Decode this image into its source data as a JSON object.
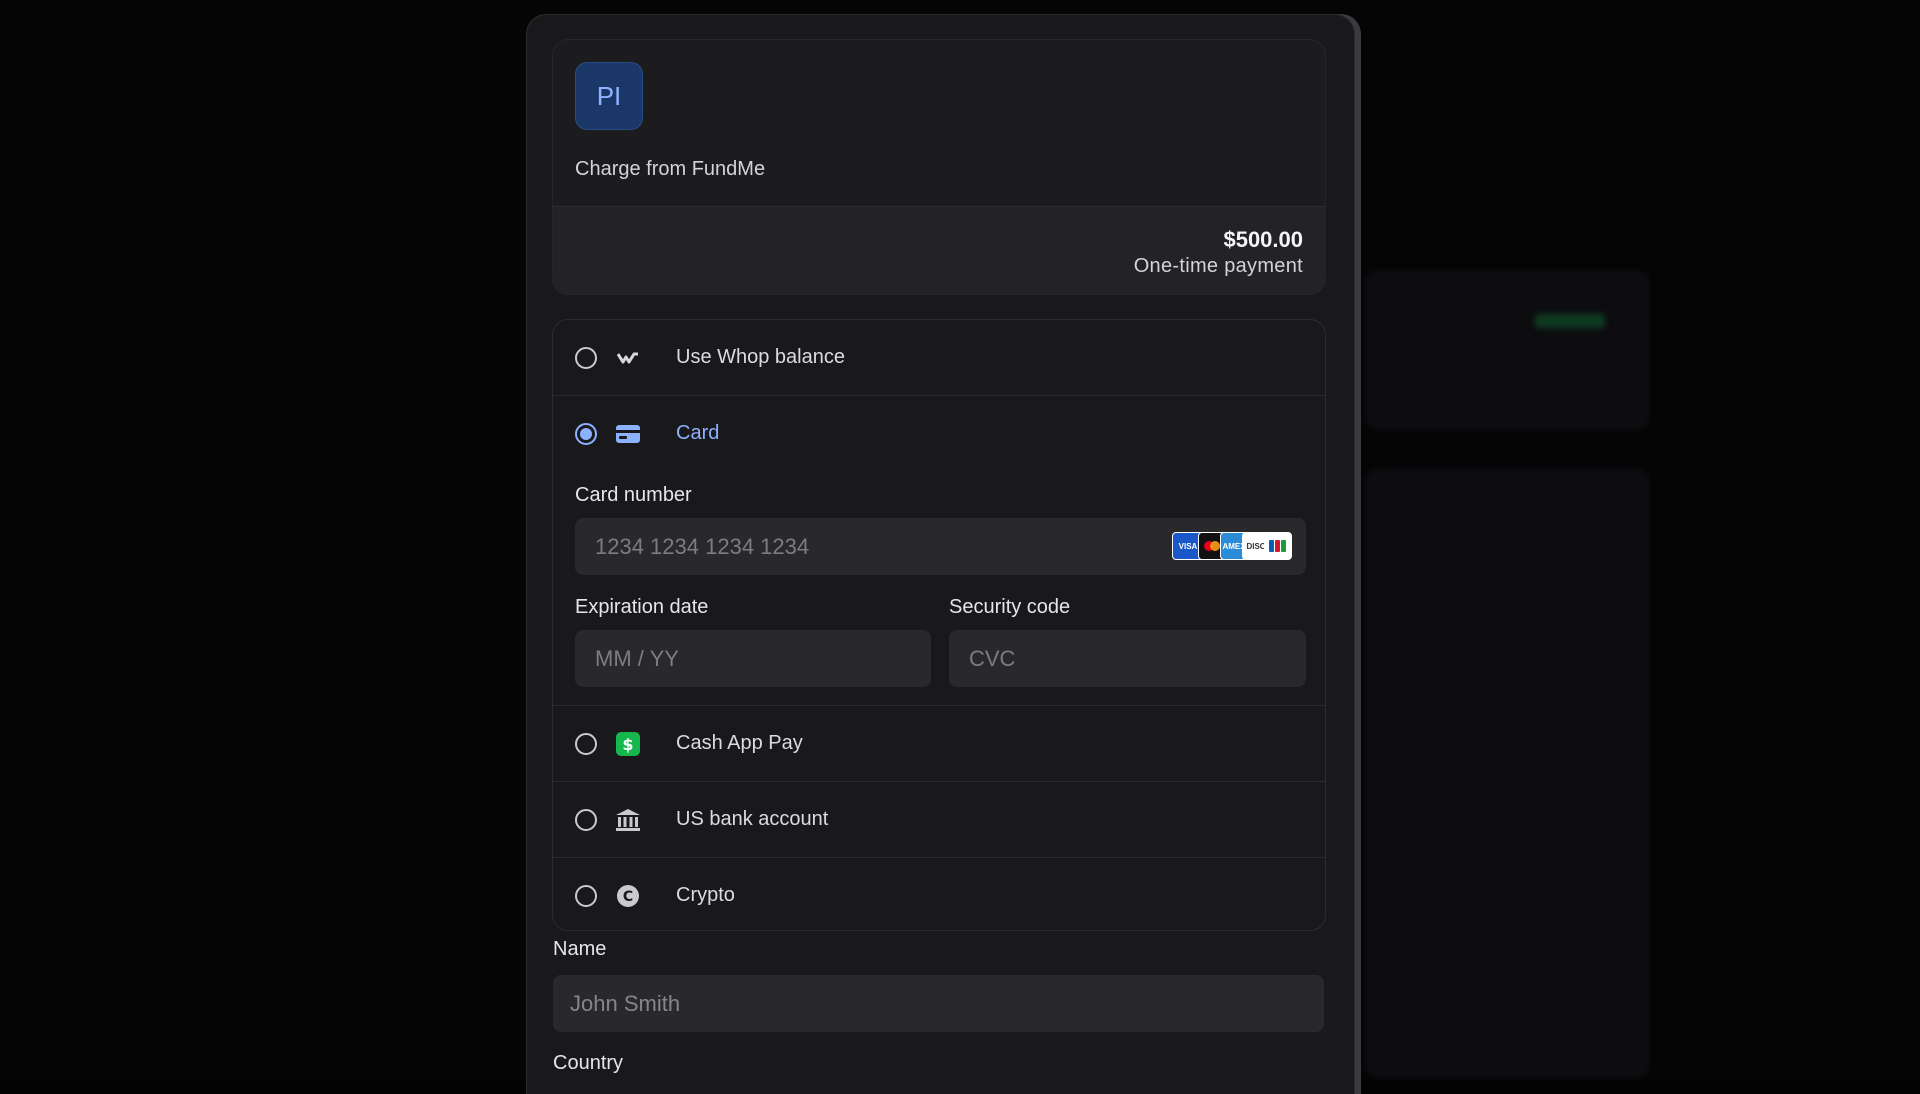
{
  "summary": {
    "logo_initials": "PI",
    "charge_text": "Charge from FundMe",
    "price": "$500.00",
    "price_sub": "One-time payment"
  },
  "methods": {
    "whop_label": "Use Whop balance",
    "card_label": "Card",
    "cashapp_label": "Cash App Pay",
    "bank_label": "US bank account",
    "crypto_label": "Crypto",
    "selected": "Card"
  },
  "card": {
    "number_label": "Card number",
    "number_placeholder": "1234 1234 1234 1234",
    "expiry_label": "Expiration date",
    "expiry_placeholder": "MM / YY",
    "cvc_label": "Security code",
    "cvc_placeholder": "CVC",
    "brands": [
      "VISA",
      "mastercard",
      "amex",
      "discover",
      "jcb"
    ]
  },
  "form": {
    "name_label": "Name",
    "name_placeholder": "John Smith",
    "country_label": "Country"
  },
  "colors": {
    "accent": "#8cb1ff",
    "logo_bg": "#1b3768",
    "cashapp": "#16b84e"
  }
}
